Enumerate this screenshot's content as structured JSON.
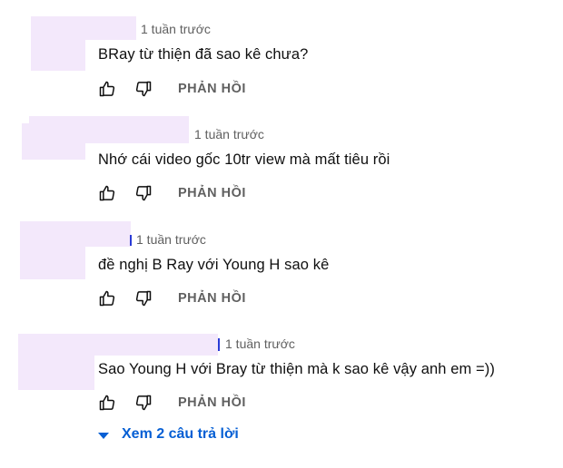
{
  "comments": [
    {
      "time": "1 tuần trước",
      "text": "BRay từ thiện đã sao kê chưa?",
      "reply_label": "PHẢN HỒI"
    },
    {
      "time": "1 tuần trước",
      "text": "Nhớ cái video gốc 10tr view mà mất tiêu rồi",
      "reply_label": "PHẢN HỒI"
    },
    {
      "time": "1 tuần trước",
      "text": "đề nghị B Ray với Young H sao kê",
      "reply_label": "PHẢN HỒI"
    },
    {
      "time": "1 tuần trước",
      "text": "Sao Young H với Bray từ thiện mà k sao kê vậy anh em =))",
      "reply_label": "PHẢN HỒI"
    }
  ],
  "view_replies": {
    "label": "Xem 2 câu trả lời"
  },
  "colors": {
    "meta": "#606060",
    "link": "#065fd4",
    "redaction": "#f3e8fb"
  },
  "icons": [
    "thumbs-up-icon",
    "thumbs-down-icon",
    "caret-down-icon"
  ]
}
